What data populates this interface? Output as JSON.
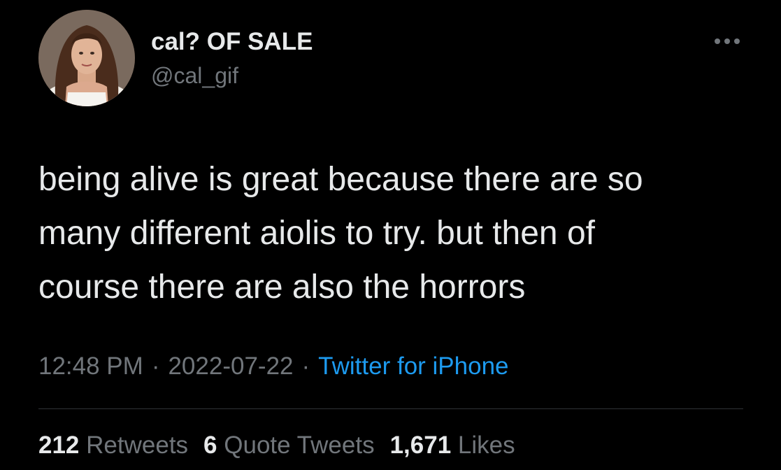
{
  "author": {
    "display_name": "cal? OF SALE",
    "handle": "@cal_gif"
  },
  "tweet": {
    "lines": [
      "being alive is great because there are so",
      "many different aiolis to try. but then of",
      "course there are also the horrors"
    ],
    "time": "12:48 PM",
    "date": "2022-07-22",
    "separator": "·",
    "source": "Twitter for iPhone"
  },
  "stats": {
    "retweets_count": "212",
    "retweets_label": "Retweets",
    "quote_tweets_count": "6",
    "quote_tweets_label": "Quote Tweets",
    "likes_count": "1,671",
    "likes_label": "Likes"
  },
  "colors": {
    "background": "#000000",
    "primary_text": "#e7e9ea",
    "secondary_text": "#71767b",
    "link": "#1d9bf0",
    "divider": "#2f3336"
  },
  "icons": {
    "more": "more-dots-icon"
  }
}
